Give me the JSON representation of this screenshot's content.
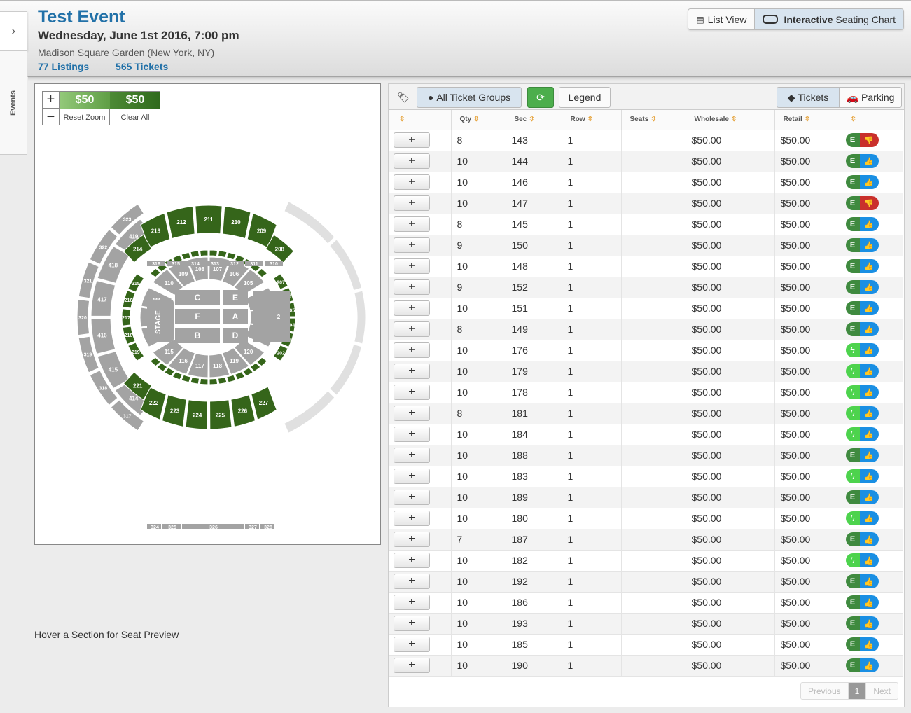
{
  "sidebar": {
    "toggle_icon": "chevron-right-icon",
    "tab_label": "Events"
  },
  "event": {
    "title": "Test Event",
    "datetime": "Wednesday, June 1st 2016, 7:00 pm",
    "venue": "Madison Square Garden (New York, NY)",
    "listings": "77 Listings",
    "tickets": "565 Tickets"
  },
  "view_toggle": {
    "list_label": "List View",
    "chart_label_bold": "Interactive",
    "chart_label_rest": "Seating Chart",
    "active": "chart"
  },
  "map": {
    "price_min": "$50",
    "price_max": "$50",
    "reset_zoom": "Reset Zoom",
    "clear_all": "Clear All",
    "stage_label": "STAGE",
    "hover_note": "Hover a Section for Seat Preview",
    "floor_sections": [
      "C",
      "F",
      "B",
      "E",
      "A",
      "D"
    ],
    "top_300s": [
      "316",
      "315",
      "314",
      "313",
      "312",
      "311",
      "310"
    ],
    "bottom_300s": [
      "324",
      "325",
      "326",
      "327",
      "328"
    ],
    "upper_200s": [
      "213",
      "212",
      "211",
      "210",
      "209",
      "214",
      "208",
      "221",
      "222",
      "223",
      "224",
      "225",
      "226",
      "227"
    ],
    "lower_100s": [
      "109",
      "108",
      "107",
      "106",
      "105",
      "110",
      "104",
      "111",
      "103",
      "112",
      "102",
      "113",
      "101",
      "114",
      "120",
      "115",
      "116",
      "117",
      "118",
      "119"
    ],
    "left_400s": [
      "414",
      "415",
      "416",
      "417",
      "418",
      "419"
    ],
    "left_300s": [
      "317",
      "318",
      "319",
      "320",
      "321",
      "322",
      "323"
    ],
    "side_200s": [
      "217",
      "218",
      "216",
      "219",
      "220",
      "207",
      "206",
      "205",
      "204",
      "203",
      "202",
      "201"
    ],
    "colors": {
      "available": "#35651a",
      "unavailable": "#a3a3a3"
    }
  },
  "toolbar": {
    "tag_icon": "tag-icon",
    "all_groups": "All Ticket Groups",
    "refresh_icon": "refresh-icon",
    "legend": "Legend",
    "tickets": "Tickets",
    "parking": "Parking"
  },
  "table": {
    "columns": [
      "",
      "Qty",
      "Sec",
      "Row",
      "Seats",
      "Wholesale",
      "Retail",
      ""
    ],
    "rows": [
      {
        "qty": "8",
        "sec": "143",
        "row": "1",
        "seats": "",
        "wholesale": "$50.00",
        "retail": "$50.00",
        "type": "E",
        "vote": "down"
      },
      {
        "qty": "10",
        "sec": "144",
        "row": "1",
        "seats": "",
        "wholesale": "$50.00",
        "retail": "$50.00",
        "type": "E",
        "vote": "up"
      },
      {
        "qty": "10",
        "sec": "146",
        "row": "1",
        "seats": "",
        "wholesale": "$50.00",
        "retail": "$50.00",
        "type": "E",
        "vote": "up"
      },
      {
        "qty": "10",
        "sec": "147",
        "row": "1",
        "seats": "",
        "wholesale": "$50.00",
        "retail": "$50.00",
        "type": "E",
        "vote": "down"
      },
      {
        "qty": "8",
        "sec": "145",
        "row": "1",
        "seats": "",
        "wholesale": "$50.00",
        "retail": "$50.00",
        "type": "E",
        "vote": "up"
      },
      {
        "qty": "9",
        "sec": "150",
        "row": "1",
        "seats": "",
        "wholesale": "$50.00",
        "retail": "$50.00",
        "type": "E",
        "vote": "up"
      },
      {
        "qty": "10",
        "sec": "148",
        "row": "1",
        "seats": "",
        "wholesale": "$50.00",
        "retail": "$50.00",
        "type": "E",
        "vote": "up"
      },
      {
        "qty": "9",
        "sec": "152",
        "row": "1",
        "seats": "",
        "wholesale": "$50.00",
        "retail": "$50.00",
        "type": "E",
        "vote": "up"
      },
      {
        "qty": "10",
        "sec": "151",
        "row": "1",
        "seats": "",
        "wholesale": "$50.00",
        "retail": "$50.00",
        "type": "E",
        "vote": "up"
      },
      {
        "qty": "8",
        "sec": "149",
        "row": "1",
        "seats": "",
        "wholesale": "$50.00",
        "retail": "$50.00",
        "type": "E",
        "vote": "up"
      },
      {
        "qty": "10",
        "sec": "176",
        "row": "1",
        "seats": "",
        "wholesale": "$50.00",
        "retail": "$50.00",
        "type": "F",
        "vote": "up"
      },
      {
        "qty": "10",
        "sec": "179",
        "row": "1",
        "seats": "",
        "wholesale": "$50.00",
        "retail": "$50.00",
        "type": "F",
        "vote": "up"
      },
      {
        "qty": "10",
        "sec": "178",
        "row": "1",
        "seats": "",
        "wholesale": "$50.00",
        "retail": "$50.00",
        "type": "F",
        "vote": "up"
      },
      {
        "qty": "8",
        "sec": "181",
        "row": "1",
        "seats": "",
        "wholesale": "$50.00",
        "retail": "$50.00",
        "type": "F",
        "vote": "up"
      },
      {
        "qty": "10",
        "sec": "184",
        "row": "1",
        "seats": "",
        "wholesale": "$50.00",
        "retail": "$50.00",
        "type": "F",
        "vote": "up"
      },
      {
        "qty": "10",
        "sec": "188",
        "row": "1",
        "seats": "",
        "wholesale": "$50.00",
        "retail": "$50.00",
        "type": "E",
        "vote": "up"
      },
      {
        "qty": "10",
        "sec": "183",
        "row": "1",
        "seats": "",
        "wholesale": "$50.00",
        "retail": "$50.00",
        "type": "F",
        "vote": "up"
      },
      {
        "qty": "10",
        "sec": "189",
        "row": "1",
        "seats": "",
        "wholesale": "$50.00",
        "retail": "$50.00",
        "type": "E",
        "vote": "up"
      },
      {
        "qty": "10",
        "sec": "180",
        "row": "1",
        "seats": "",
        "wholesale": "$50.00",
        "retail": "$50.00",
        "type": "F",
        "vote": "up"
      },
      {
        "qty": "7",
        "sec": "187",
        "row": "1",
        "seats": "",
        "wholesale": "$50.00",
        "retail": "$50.00",
        "type": "E",
        "vote": "up"
      },
      {
        "qty": "10",
        "sec": "182",
        "row": "1",
        "seats": "",
        "wholesale": "$50.00",
        "retail": "$50.00",
        "type": "F",
        "vote": "up"
      },
      {
        "qty": "10",
        "sec": "192",
        "row": "1",
        "seats": "",
        "wholesale": "$50.00",
        "retail": "$50.00",
        "type": "E",
        "vote": "up"
      },
      {
        "qty": "10",
        "sec": "186",
        "row": "1",
        "seats": "",
        "wholesale": "$50.00",
        "retail": "$50.00",
        "type": "E",
        "vote": "up"
      },
      {
        "qty": "10",
        "sec": "193",
        "row": "1",
        "seats": "",
        "wholesale": "$50.00",
        "retail": "$50.00",
        "type": "E",
        "vote": "up"
      },
      {
        "qty": "10",
        "sec": "185",
        "row": "1",
        "seats": "",
        "wholesale": "$50.00",
        "retail": "$50.00",
        "type": "E",
        "vote": "up"
      },
      {
        "qty": "10",
        "sec": "190",
        "row": "1",
        "seats": "",
        "wholesale": "$50.00",
        "retail": "$50.00",
        "type": "E",
        "vote": "up"
      }
    ]
  },
  "pagination": {
    "previous": "Previous",
    "current": "1",
    "next": "Next"
  }
}
